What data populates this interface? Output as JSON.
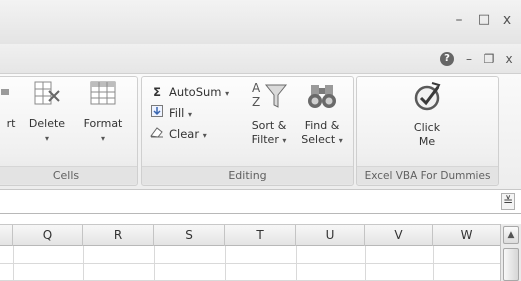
{
  "window_controls": {
    "minimize": "–",
    "maximize": "□",
    "close": "x"
  },
  "workbook_controls": {
    "help": "?",
    "minimize": "–",
    "restore": "❐",
    "close": "x"
  },
  "ribbon": {
    "cells_group": {
      "label": "Cells",
      "insert_partial": "rt",
      "delete": "Delete",
      "format": "Format",
      "caret": "▾"
    },
    "editing_group": {
      "label": "Editing",
      "autosum": "AutoSum",
      "autosum_symbol": "Σ",
      "fill": "Fill",
      "clear": "Clear",
      "sort_filter_line1": "Sort &",
      "sort_filter_line2": "Filter",
      "find_select_line1": "Find &",
      "find_select_line2": "Select",
      "caret": "▾"
    },
    "custom_group": {
      "label": "Excel VBA For Dummies",
      "click_line1": "Click",
      "click_line2": "Me"
    }
  },
  "formula_bar": {
    "expand": "≚"
  },
  "columns": [
    "Q",
    "R",
    "S",
    "T",
    "U",
    "V",
    "W"
  ],
  "scrollbar": {
    "up": "▲"
  },
  "icons": {
    "insert": "insert-cells-icon",
    "delete": "delete-cells-icon",
    "format": "format-cells-icon",
    "autosum": "sigma-icon",
    "fill": "fill-down-icon",
    "clear": "eraser-icon",
    "sort_filter": "sort-filter-icon",
    "find_select": "binoculars-icon",
    "click_me": "smiley-check-icon"
  }
}
